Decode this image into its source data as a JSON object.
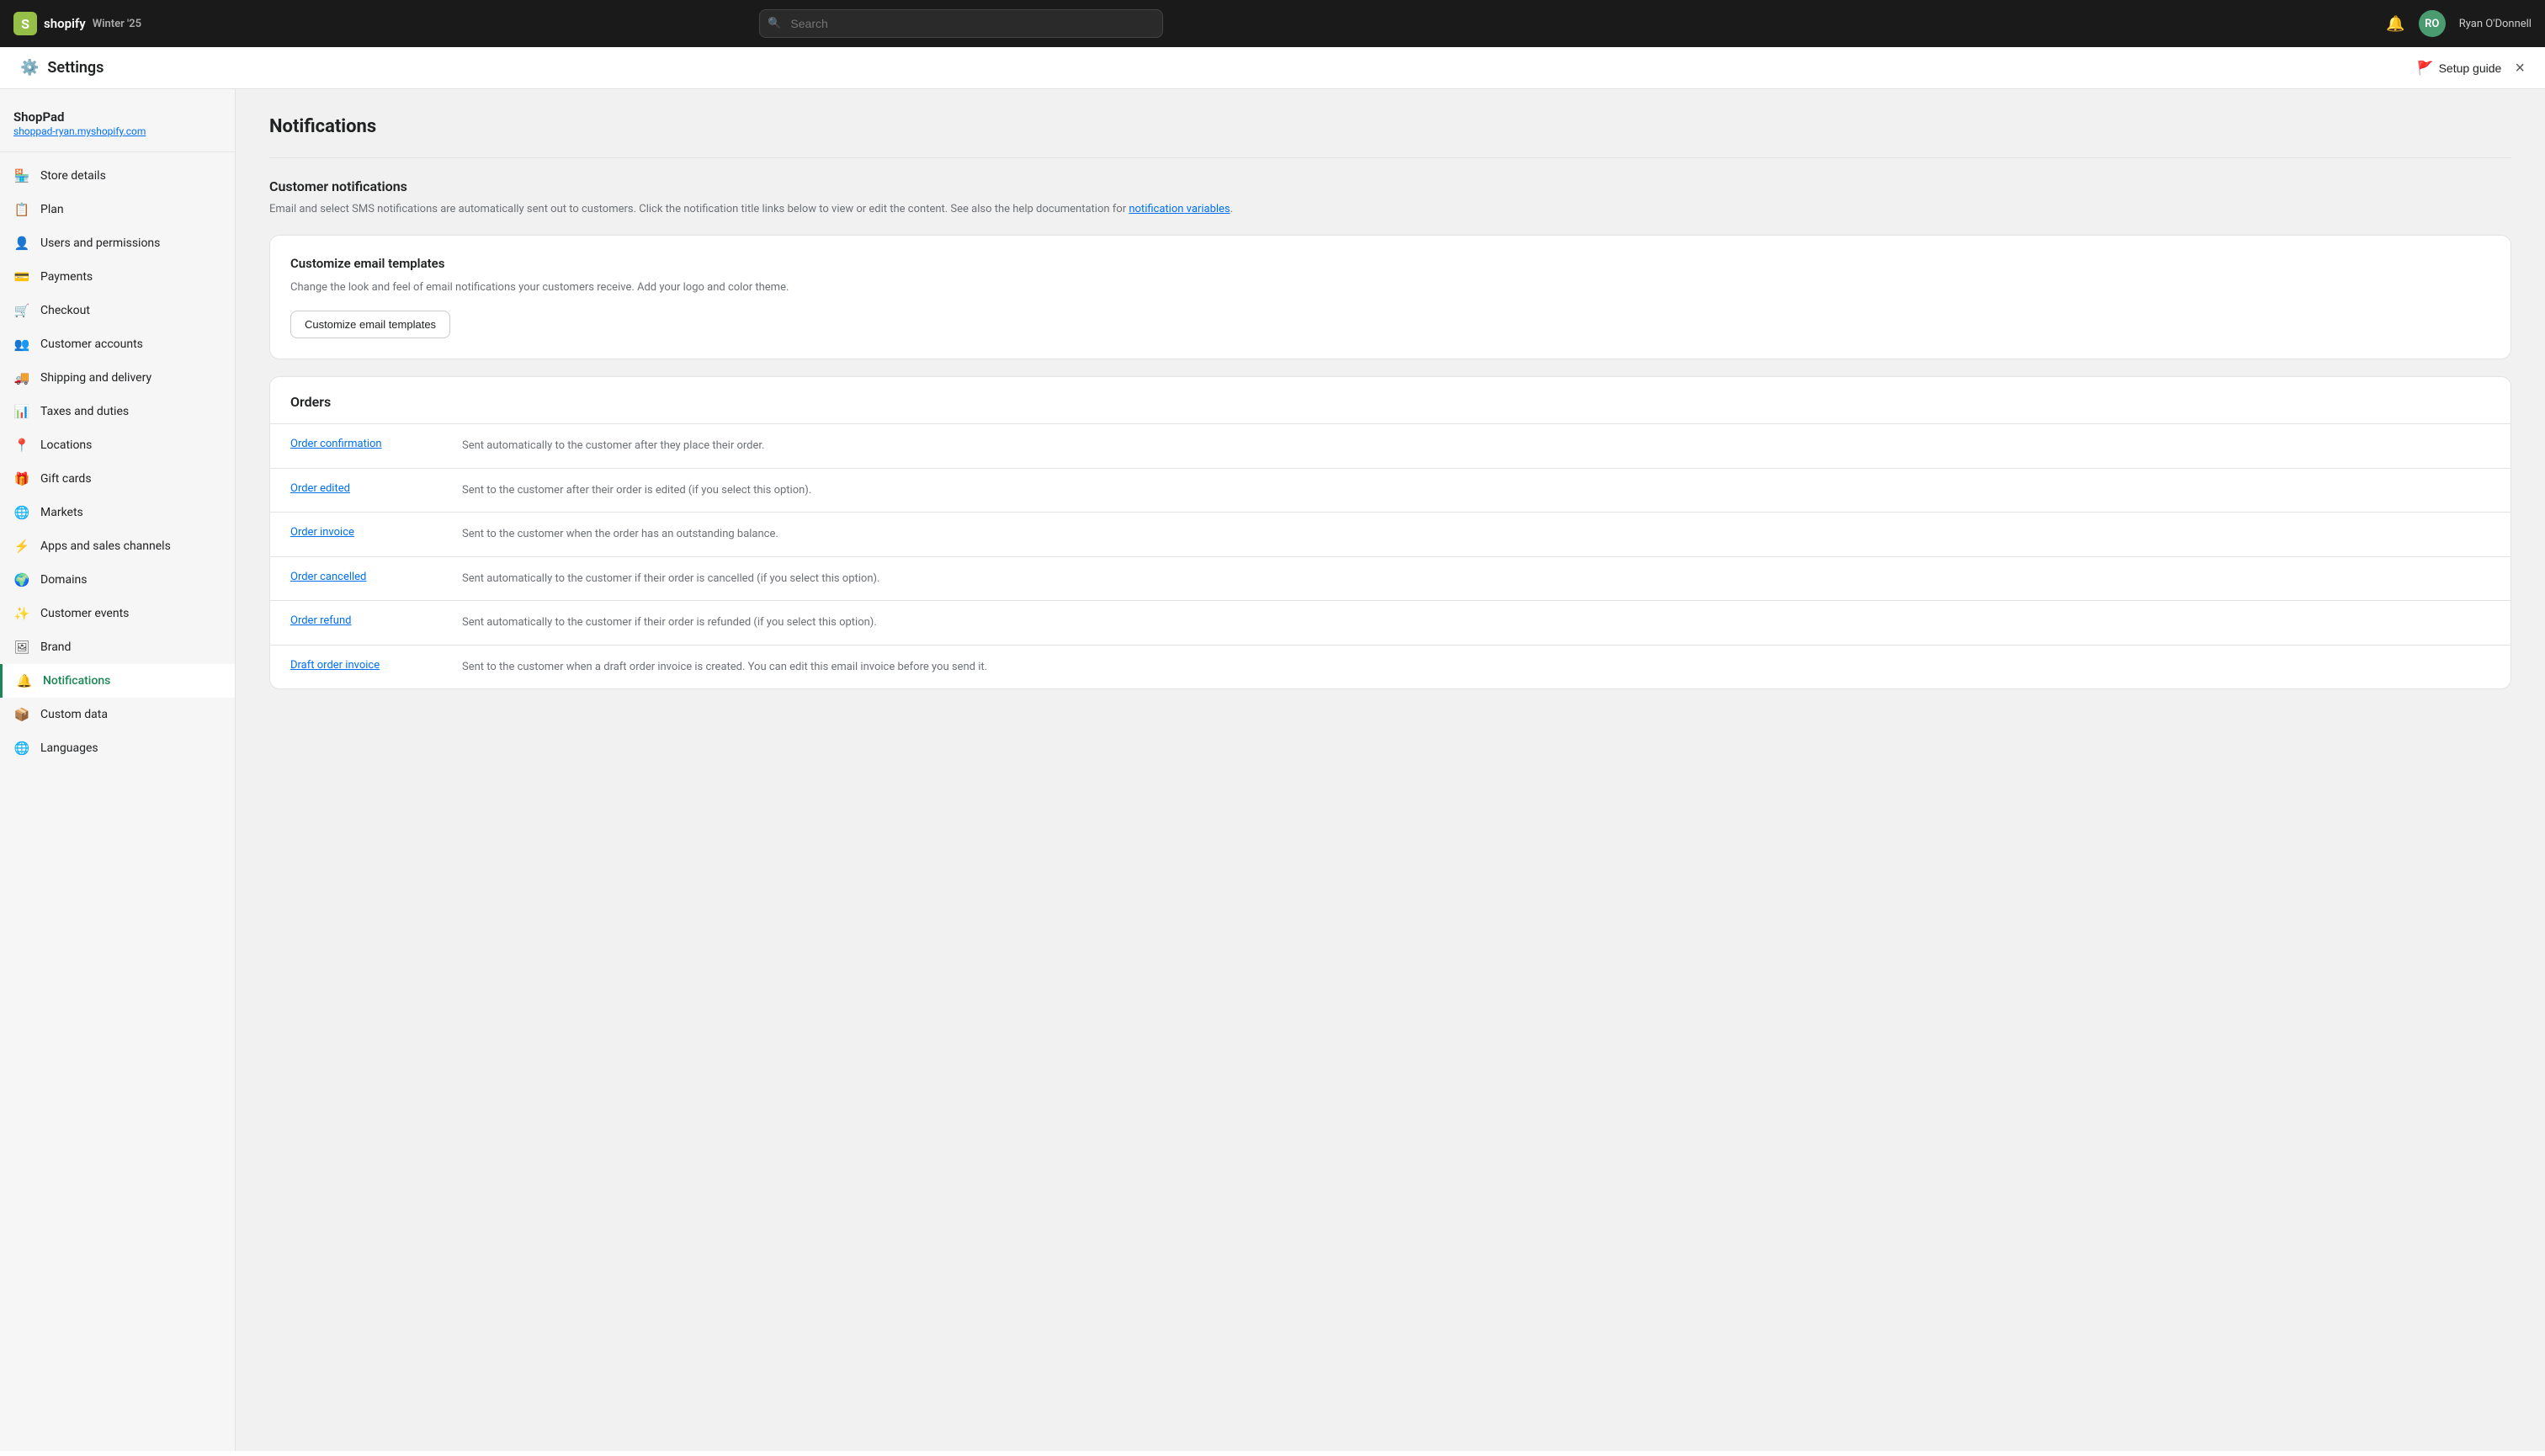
{
  "topbar": {
    "logo_icon": "S",
    "store_name": "Winter '25",
    "search_placeholder": "Search",
    "username": "Ryan O'Donnell",
    "avatar_initials": "RO"
  },
  "settings": {
    "title": "Settings",
    "setup_guide_label": "Setup guide",
    "close_label": "×"
  },
  "sidebar": {
    "shop_name": "ShopPad",
    "shop_url": "shoppad-ryan.myshopify.com",
    "items": [
      {
        "id": "store-details",
        "label": "Store details",
        "icon": "🏪"
      },
      {
        "id": "plan",
        "label": "Plan",
        "icon": "📋"
      },
      {
        "id": "users-permissions",
        "label": "Users and permissions",
        "icon": "👤"
      },
      {
        "id": "payments",
        "label": "Payments",
        "icon": "💳"
      },
      {
        "id": "checkout",
        "label": "Checkout",
        "icon": "🛒"
      },
      {
        "id": "customer-accounts",
        "label": "Customer accounts",
        "icon": "👥"
      },
      {
        "id": "shipping-delivery",
        "label": "Shipping and delivery",
        "icon": "🚚"
      },
      {
        "id": "taxes-duties",
        "label": "Taxes and duties",
        "icon": "📊"
      },
      {
        "id": "locations",
        "label": "Locations",
        "icon": "📍"
      },
      {
        "id": "gift-cards",
        "label": "Gift cards",
        "icon": "🎁"
      },
      {
        "id": "markets",
        "label": "Markets",
        "icon": "🌐"
      },
      {
        "id": "apps-sales-channels",
        "label": "Apps and sales channels",
        "icon": "⚡"
      },
      {
        "id": "domains",
        "label": "Domains",
        "icon": "🌍"
      },
      {
        "id": "customer-events",
        "label": "Customer events",
        "icon": "✨"
      },
      {
        "id": "brand",
        "label": "Brand",
        "icon": "🖼"
      },
      {
        "id": "notifications",
        "label": "Notifications",
        "icon": "🔔",
        "active": true
      },
      {
        "id": "custom-data",
        "label": "Custom data",
        "icon": "📦"
      },
      {
        "id": "languages",
        "label": "Languages",
        "icon": "🌐"
      }
    ]
  },
  "main": {
    "page_title": "Notifications",
    "customer_notifications": {
      "heading": "Customer notifications",
      "description": "Email and select SMS notifications are automatically sent out to customers. Click the notification title links below to view or edit the content. See also the help documentation for",
      "link_text": "notification variables",
      "link_after": "."
    },
    "customize_card": {
      "title": "Customize email templates",
      "description": "Change the look and feel of email notifications your customers receive. Add your logo and color theme.",
      "button_label": "Customize email templates"
    },
    "orders": {
      "title": "Orders",
      "notifications": [
        {
          "link": "Order confirmation",
          "description": "Sent automatically to the customer after they place their order."
        },
        {
          "link": "Order edited",
          "description": "Sent to the customer after their order is edited (if you select this option)."
        },
        {
          "link": "Order invoice",
          "description": "Sent to the customer when the order has an outstanding balance."
        },
        {
          "link": "Order cancelled",
          "description": "Sent automatically to the customer if their order is cancelled (if you select this option)."
        },
        {
          "link": "Order refund",
          "description": "Sent automatically to the customer if their order is refunded (if you select this option)."
        },
        {
          "link": "Draft order invoice",
          "description": "Sent to the customer when a draft order invoice is created. You can edit this email invoice before you send it."
        }
      ]
    }
  }
}
